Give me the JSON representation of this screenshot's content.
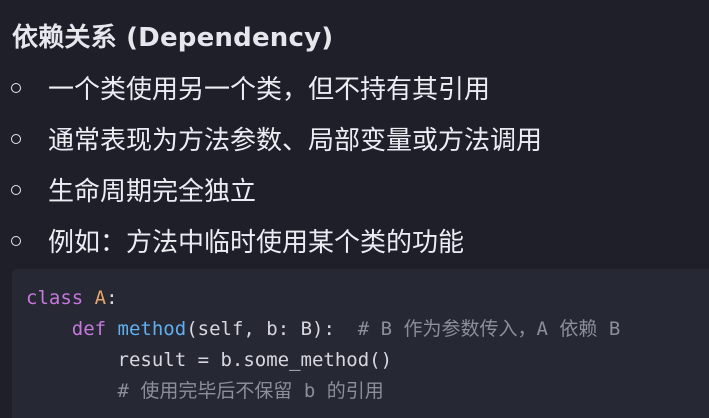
{
  "heading": {
    "main": "依赖关系",
    "sub": "(Dependency)"
  },
  "bullets": [
    {
      "text": "一个类使用另一个类，但不持有其引用"
    },
    {
      "text": "通常表现为方法参数、局部变量或方法调用"
    },
    {
      "text": "生命周期完全独立"
    },
    {
      "text": "例如：方法中临时使用某个类的功能"
    }
  ],
  "code": {
    "line1": {
      "kw": "class",
      "space": " ",
      "cls": "A",
      "colon": ":"
    },
    "line2": {
      "indent": "    ",
      "kw": "def",
      "space": " ",
      "fn": "method",
      "params": "(self, b: B):",
      "gap": "  ",
      "comment": "# B 作为参数传入，A 依赖 B"
    },
    "line3": {
      "indent": "        ",
      "text": "result = b.some_method()"
    },
    "line4": {
      "indent": "        ",
      "comment": "# 使用完毕后不保留 b 的引用"
    }
  },
  "colors": {
    "background": "#1f1f29",
    "code_background": "#262833",
    "keyword": "#c678dd",
    "class_name": "#e5a66b",
    "function_name": "#61afef",
    "comment": "#8a8f99"
  }
}
